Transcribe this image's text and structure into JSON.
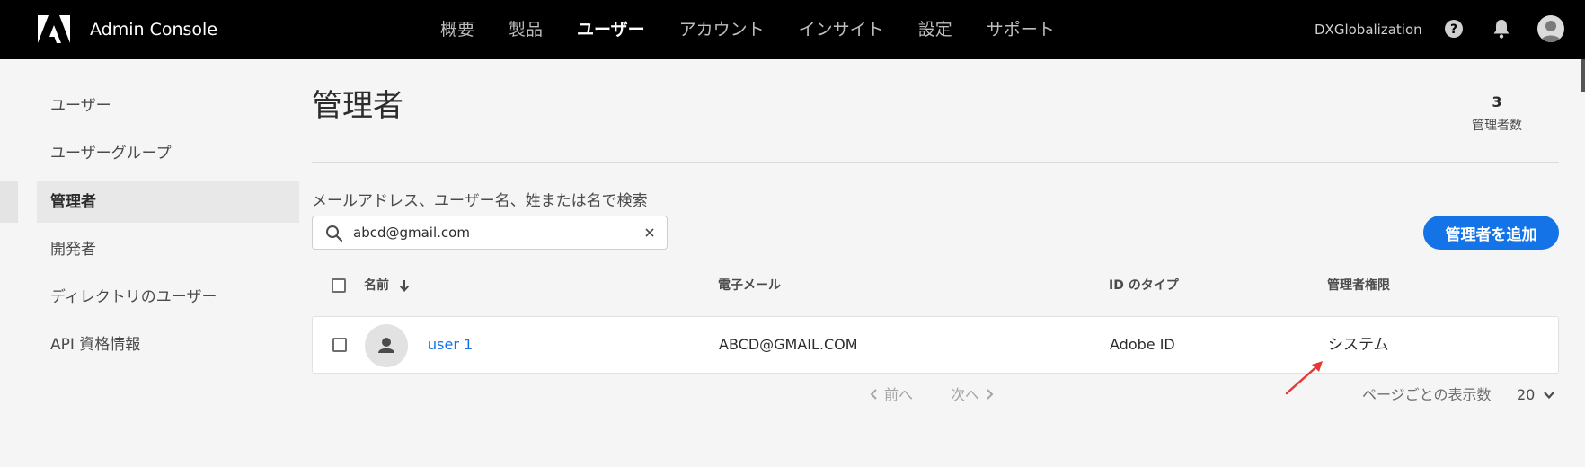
{
  "header": {
    "app_title": "Admin Console",
    "nav": [
      "概要",
      "製品",
      "ユーザー",
      "アカウント",
      "インサイト",
      "設定",
      "サポート"
    ],
    "active_nav_index": 2,
    "org_name": "DXGlobalization",
    "icons": [
      "adobe-logo-icon",
      "help-icon",
      "bell-icon",
      "avatar-icon"
    ]
  },
  "sidebar": {
    "items": [
      {
        "label": "ユーザー"
      },
      {
        "label": "ユーザーグループ"
      },
      {
        "label": "管理者"
      },
      {
        "label": "開発者"
      },
      {
        "label": "ディレクトリのユーザー"
      },
      {
        "label": "API 資格情報"
      }
    ],
    "selected_index": 2
  },
  "main": {
    "title": "管理者",
    "count": {
      "value": "3",
      "label": "管理者数"
    },
    "search": {
      "label": "メールアドレス、ユーザー名、姓または名で検索",
      "value": "abcd@gmail.com"
    },
    "add_button": "管理者を追加",
    "table": {
      "headers": {
        "name": "名前",
        "email": "電子メール",
        "id_type": "ID のタイプ",
        "role": "管理者権限"
      },
      "rows": [
        {
          "name": "user 1",
          "email": "ABCD@GMAIL.COM",
          "id_type": "Adobe ID",
          "role": "システム"
        }
      ]
    },
    "pagination": {
      "prev": "前へ",
      "next": "次へ",
      "per_page_label": "ページごとの表示数",
      "per_page_value": "20"
    }
  },
  "colors": {
    "topbar": "#000000",
    "accent": "#1473e6",
    "background": "#f5f5f5",
    "annotation_arrow": "#e53935"
  }
}
